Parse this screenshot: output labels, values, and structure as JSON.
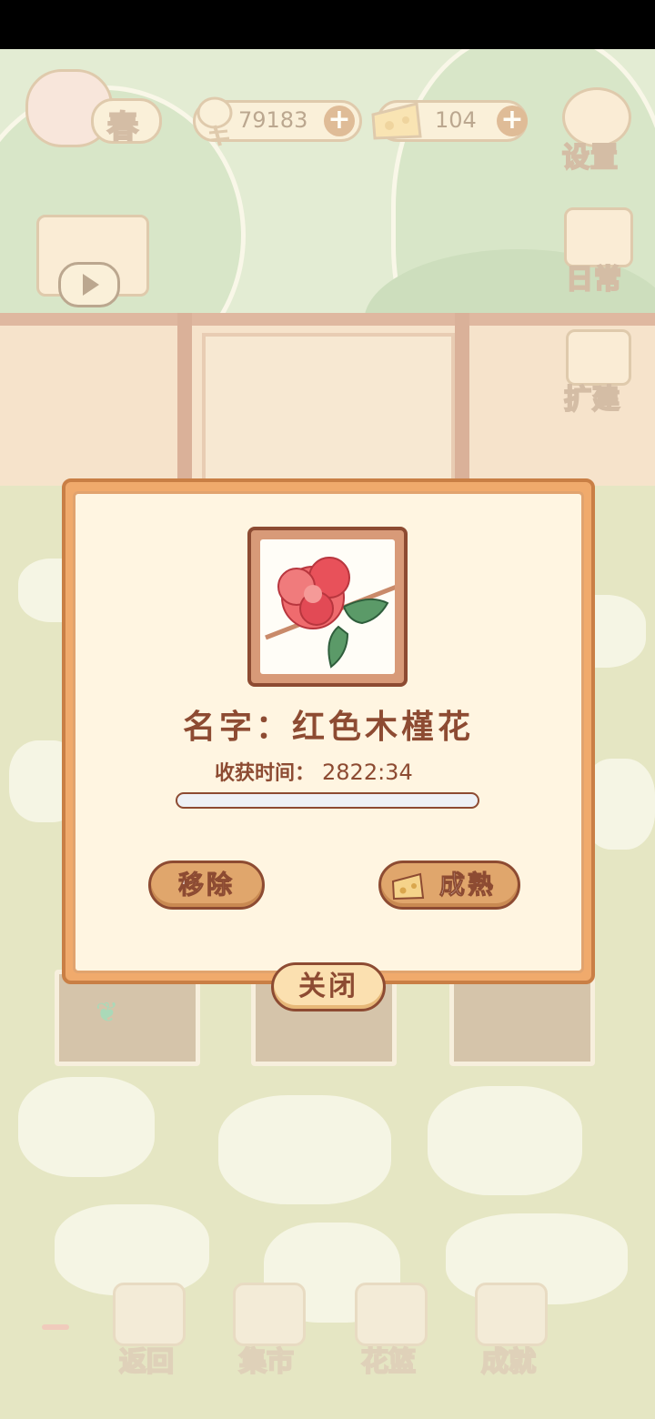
{
  "hud": {
    "season_label": "春",
    "fish_count": "79183",
    "cheese_count": "104"
  },
  "side_menu": {
    "settings_label": "设置",
    "daily_label": "日常",
    "expand_label": "扩建"
  },
  "dialog": {
    "name_label": "名字：",
    "name_value": "红色木槿花",
    "harvest_label": "收获时间：",
    "harvest_value": "2822:34",
    "progress": 0.0,
    "remove_label": "移除",
    "ripen_label": "成熟",
    "close_label": "关闭"
  },
  "bottom_nav": {
    "back_label": "返回",
    "market_label": "集市",
    "basket_label": "花篮",
    "achievement_label": "成就"
  },
  "colors": {
    "accent_brown": "#8d4b32",
    "dialog_orange": "#f0aa6c",
    "flower_red": "#e8515a"
  }
}
